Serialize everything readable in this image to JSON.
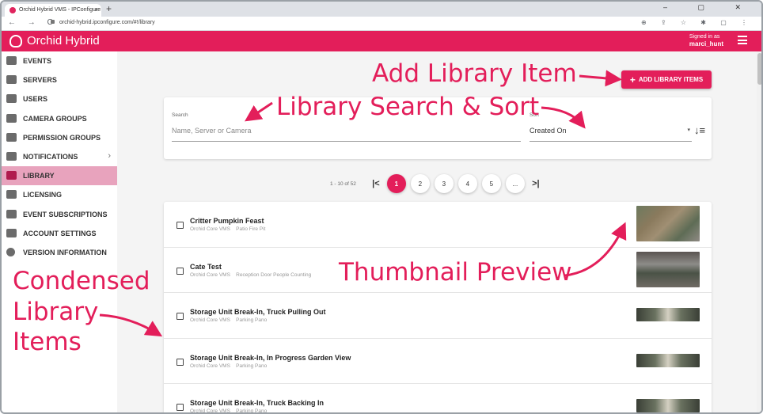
{
  "browser": {
    "tab_title": "Orchid Hybrid VMS - IPConfigure",
    "tab_close": "×",
    "new_tab": "+",
    "url": "orchid-hybrid.ipconfigure.com/#!/library",
    "nav_icons": "← → C",
    "right_icons": "⊕ ⇪ ☆ ✱ ▢ ⋮",
    "window_buttons": "– ▢ ✕"
  },
  "header": {
    "brand": "Orchid Hybrid",
    "signed_in_label": "Signed in as",
    "username": "marci_hunt"
  },
  "sidebar": {
    "items": [
      {
        "label": "EVENTS",
        "icon": "events-icon"
      },
      {
        "label": "SERVERS",
        "icon": "servers-icon"
      },
      {
        "label": "USERS",
        "icon": "user-icon"
      },
      {
        "label": "CAMERA GROUPS",
        "icon": "camera-groups-icon"
      },
      {
        "label": "PERMISSION GROUPS",
        "icon": "permission-groups-icon"
      },
      {
        "label": "NOTIFICATIONS",
        "icon": "bell-icon",
        "chevron": "›"
      },
      {
        "label": "LIBRARY",
        "icon": "bookmark-icon",
        "active": true
      },
      {
        "label": "LICENSING",
        "icon": "license-icon"
      },
      {
        "label": "EVENT SUBSCRIPTIONS",
        "icon": "event-subscriptions-icon"
      },
      {
        "label": "ACCOUNT SETTINGS",
        "icon": "account-settings-icon"
      },
      {
        "label": "VERSION INFORMATION",
        "icon": "info-icon"
      }
    ]
  },
  "toolbar": {
    "add_plus": "+",
    "add_label": "ADD LIBRARY ITEMS"
  },
  "search": {
    "label": "Search",
    "placeholder": "Name, Server or Camera",
    "sort_label": "Sort",
    "sort_value": "Created On",
    "sort_caret": "▾",
    "sort_icon": "↓≡"
  },
  "pagination": {
    "count": "1 - 10 of 52",
    "first": "|<",
    "last": ">|",
    "pages": [
      "1",
      "2",
      "3",
      "4",
      "5",
      "..."
    ],
    "active_page": "1"
  },
  "library": {
    "items": [
      {
        "title": "Critter Pumpkin Feast",
        "server": "Orchid Core VMS",
        "camera": "Patio Fire Pit"
      },
      {
        "title": "Cate Test",
        "server": "Orchid Core VMS",
        "camera": "Reception Door People Counting"
      },
      {
        "title": "Storage Unit Break-In, Truck Pulling Out",
        "server": "Orchid Core VMS",
        "camera": "Parking Pano"
      },
      {
        "title": "Storage Unit Break-In, In Progress Garden View",
        "server": "Orchid Core VMS",
        "camera": "Parking Pano"
      },
      {
        "title": "Storage Unit Break-In, Truck Backing In",
        "server": "Orchid Core VMS",
        "camera": "Parking Pano"
      }
    ]
  },
  "annotations": {
    "add": "Add Library Item",
    "search": "Library Search & Sort",
    "thumbnail": "Thumbnail Preview",
    "condensed_1": "Condensed",
    "condensed_2": "Library",
    "condensed_3": "Items"
  },
  "colors": {
    "accent": "#e31e5a",
    "sidebar_active": "#e8a3bd"
  }
}
